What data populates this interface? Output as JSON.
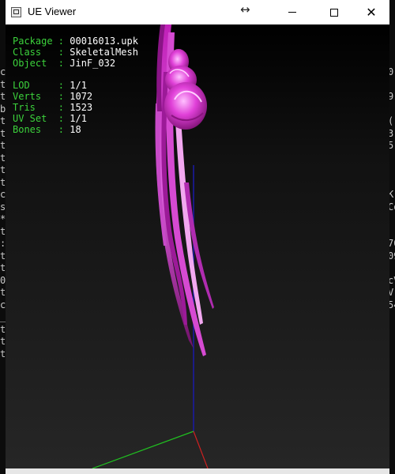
{
  "window": {
    "title": "UE Viewer"
  },
  "info": {
    "rows1": [
      {
        "label": "Package",
        "value": "00016013.upk"
      },
      {
        "label": "Class",
        "value": "SkeletalMesh"
      },
      {
        "label": "Object",
        "value": "JinF_032"
      }
    ],
    "rows2": [
      {
        "label": "LOD",
        "value": "1/1"
      },
      {
        "label": "Verts",
        "value": "1072"
      },
      {
        "label": "Tris",
        "value": "1523"
      },
      {
        "label": "UV Set",
        "value": "1/1"
      },
      {
        "label": "Bones",
        "value": "18"
      }
    ]
  },
  "background_console": {
    "left": [
      "c",
      "t",
      "t",
      "b",
      "t",
      "t",
      "t",
      "t",
      "t",
      "t",
      "c",
      "s",
      "*",
      "t",
      ":",
      "t",
      "t",
      "0",
      "t",
      "c",
      "_",
      "t",
      "t",
      "t"
    ],
    "right": [
      "0",
      "",
      "9",
      "",
      "(",
      "3",
      "5",
      "",
      "",
      "",
      "K",
      "Co",
      "",
      "",
      "70",
      "09",
      "",
      "cV",
      "V",
      "54",
      "",
      "",
      "",
      ""
    ]
  }
}
